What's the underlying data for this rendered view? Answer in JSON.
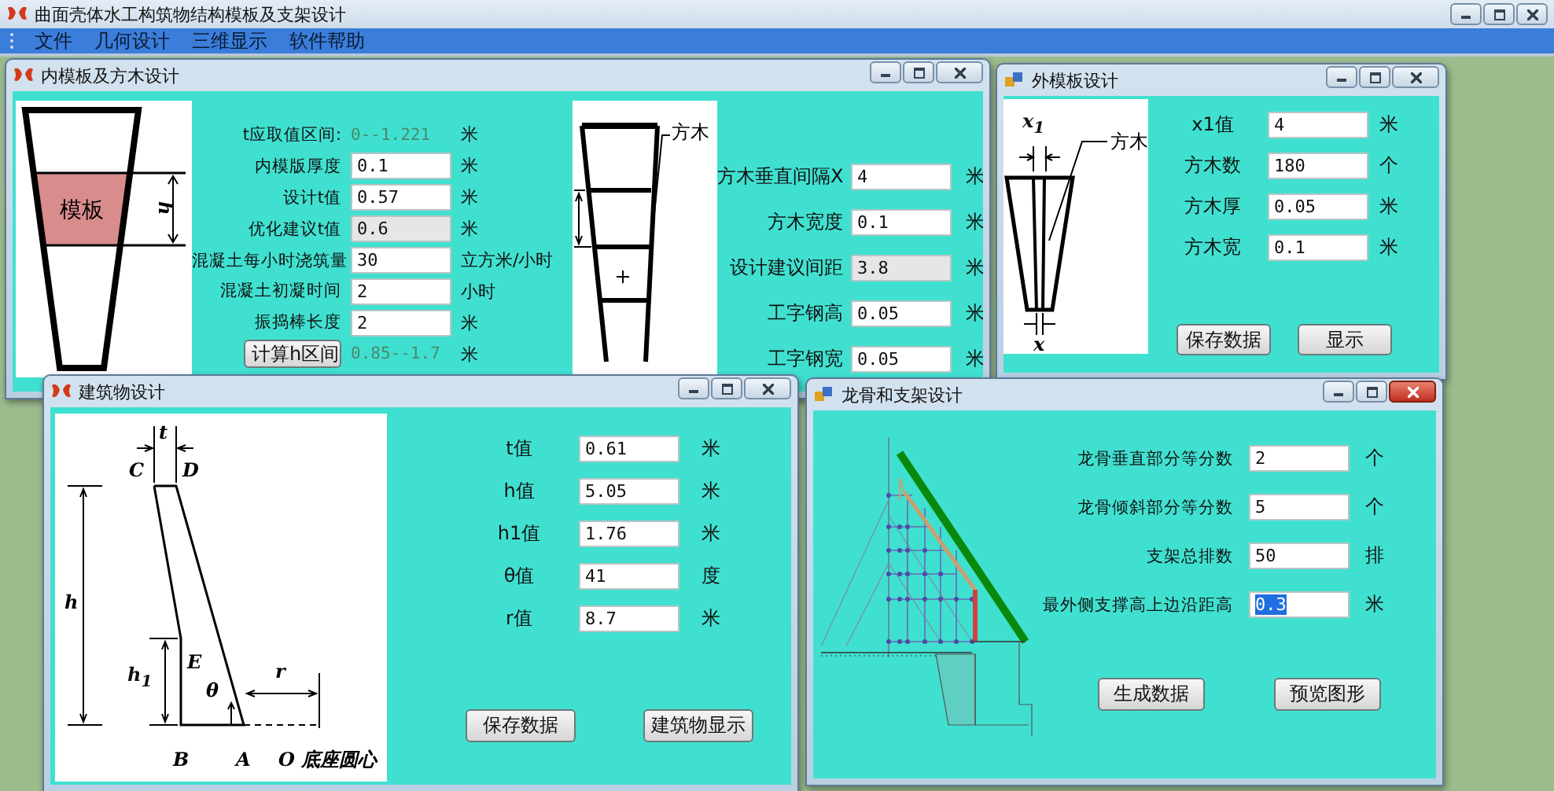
{
  "main_window": {
    "title": "曲面壳体水工构筑物结构模板及支架设计"
  },
  "menu": [
    {
      "label": "文件"
    },
    {
      "label": "几何设计"
    },
    {
      "label": "三维显示"
    },
    {
      "label": "软件帮助"
    }
  ],
  "inner_formwork": {
    "title": "内模板及方木设计",
    "active": false,
    "figure": {
      "formwork_label": "模板",
      "dimension_label": "h",
      "timber_label": "方木"
    },
    "range": {
      "label": "t应取值区间:",
      "value": "0--1.221",
      "unit": "米"
    },
    "fields": [
      {
        "label": "内模版厚度",
        "value": "0.1",
        "unit": "米",
        "disabled": false
      },
      {
        "label": "设计t值",
        "value": "0.57",
        "unit": "米",
        "disabled": false
      },
      {
        "label": "优化建议t值",
        "value": "0.6",
        "unit": "米",
        "disabled": true
      },
      {
        "label": "混凝土每小时浇筑量",
        "value": "30",
        "unit": "立方米/小时",
        "disabled": false
      },
      {
        "label": "混凝土初凝时间",
        "value": "2",
        "unit": "小时",
        "disabled": false
      },
      {
        "label": "振捣棒长度",
        "value": "2",
        "unit": "米",
        "disabled": false
      }
    ],
    "calc": {
      "button": "计算h区间",
      "result": "0.85--1.7",
      "unit": "米"
    },
    "timber_fields": [
      {
        "label": "方木垂直间隔X",
        "value": "4",
        "unit": "米",
        "disabled": false
      },
      {
        "label": "方木宽度",
        "value": "0.1",
        "unit": "米",
        "disabled": false
      },
      {
        "label": "设计建议间距",
        "value": "3.8",
        "unit": "米",
        "disabled": true
      },
      {
        "label": "工字钢高",
        "value": "0.05",
        "unit": "米",
        "disabled": false
      },
      {
        "label": "工字钢宽",
        "value": "0.05",
        "unit": "米",
        "disabled": false
      }
    ]
  },
  "outer_formwork": {
    "title": "外模板设计",
    "active": false,
    "figure": {
      "top_label": "x$_{1}$",
      "timber_label": "方木",
      "bottom_label": "x"
    },
    "fields": [
      {
        "label": "x1值",
        "value": "4",
        "unit": "米"
      },
      {
        "label": "方木数",
        "value": "180",
        "unit": "个"
      },
      {
        "label": "方木厚",
        "value": "0.05",
        "unit": "米"
      },
      {
        "label": "方木宽",
        "value": "0.1",
        "unit": "米"
      }
    ],
    "buttons": [
      "保存数据",
      "显示"
    ]
  },
  "building": {
    "title": "建筑物设计",
    "active": false,
    "figure": {
      "t": "t",
      "c": "C",
      "d": "D",
      "h": "h",
      "e": "E",
      "h1": "h$_{1}$",
      "theta": "θ",
      "r": "r",
      "b": "B",
      "a": "A",
      "o": "O 底座圆心"
    },
    "fields": [
      {
        "label": "t值",
        "value": "0.61",
        "unit": "米"
      },
      {
        "label": "h值",
        "value": "5.05",
        "unit": "米"
      },
      {
        "label": "h1值",
        "value": "1.76",
        "unit": "米"
      },
      {
        "label": "θ值",
        "value": "41",
        "unit": "度"
      },
      {
        "label": "r值",
        "value": "8.7",
        "unit": "米"
      }
    ],
    "buttons": [
      "保存数据",
      "建筑物显示"
    ]
  },
  "bracing": {
    "title": "龙骨和支架设计",
    "active": true,
    "fields": [
      {
        "label": "龙骨垂直部分等分数",
        "value": "2",
        "unit": "个",
        "highlighted": false
      },
      {
        "label": "龙骨倾斜部分等分数",
        "value": "5",
        "unit": "个",
        "highlighted": false
      },
      {
        "label": "支架总排数",
        "value": "50",
        "unit": "排",
        "highlighted": false
      },
      {
        "label": "最外侧支撑高上边沿距高",
        "value": "0.3",
        "unit": "米",
        "highlighted": true
      }
    ],
    "buttons": [
      "生成数据",
      "预览图形"
    ]
  }
}
